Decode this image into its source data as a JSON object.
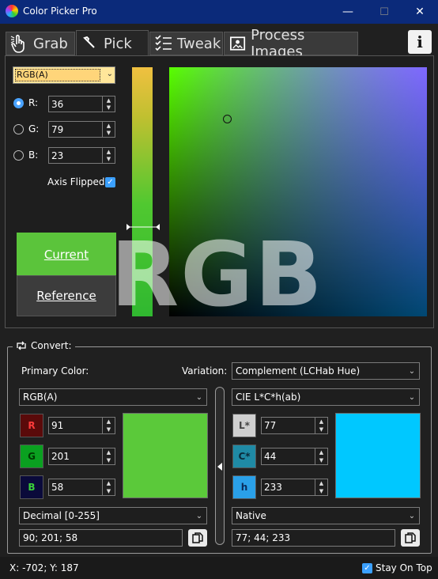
{
  "window": {
    "title": "Color Picker Pro",
    "controls": {
      "minimize": "—",
      "maximize": "☐",
      "close": "✕"
    }
  },
  "tabs": [
    {
      "label": "Grab",
      "icon": "hand-pointer-icon",
      "active": false
    },
    {
      "label": "Pick",
      "icon": "eyedropper-icon",
      "active": true
    },
    {
      "label": "Tweak",
      "icon": "checklist-icon",
      "active": false
    },
    {
      "label": "Process Images",
      "icon": "image-icon",
      "active": false
    }
  ],
  "info_button": {
    "label": "i",
    "icon": "info-icon"
  },
  "picker": {
    "color_space": "RGB(A)",
    "channels": [
      {
        "label": "R:",
        "value": "36",
        "selected": true
      },
      {
        "label": "G:",
        "value": "79",
        "selected": false
      },
      {
        "label": "B:",
        "value": "23",
        "selected": false
      }
    ],
    "axis_flipped_label": "Axis Flipped",
    "axis_flipped": true,
    "current_label": "Current",
    "reference_label": "Reference",
    "current_color": "#5bc43b",
    "reference_color": "#3c3c3c",
    "watermark": "RGB"
  },
  "convert": {
    "legend": "Convert:",
    "primary_label": "Primary Color:",
    "variation_label": "Variation:",
    "variation_value": "Complement (LCHab Hue)",
    "left": {
      "space": "RGB(A)",
      "channels": [
        {
          "label": "R",
          "value": "91",
          "bg": "#5a0a0a",
          "fg": "#ff3a3a"
        },
        {
          "label": "G",
          "value": "201",
          "bg": "#0aa020",
          "fg": "#003a00"
        },
        {
          "label": "B",
          "value": "58",
          "bg": "#0a0a3a",
          "fg": "#3ad03a"
        }
      ],
      "swatch": "#5bc93a",
      "format": "Decimal [0-255]",
      "text": "90; 201; 58"
    },
    "right": {
      "space": "CIE L*C*h(ab)",
      "channels": [
        {
          "label": "L*",
          "value": "77",
          "bg": "#cfcfcf",
          "fg": "#444444"
        },
        {
          "label": "C*",
          "value": "44",
          "bg": "#1f8aa5",
          "fg": "#0a2a3a"
        },
        {
          "label": "h",
          "value": "233",
          "bg": "#2aa0e8",
          "fg": "#0a2a5a"
        }
      ],
      "swatch": "#00c8ff",
      "format": "Native",
      "text": "77; 44; 233"
    }
  },
  "status": {
    "coords": "X: -702; Y: 187",
    "stay_on_top_label": "Stay On Top",
    "stay_on_top": true
  }
}
